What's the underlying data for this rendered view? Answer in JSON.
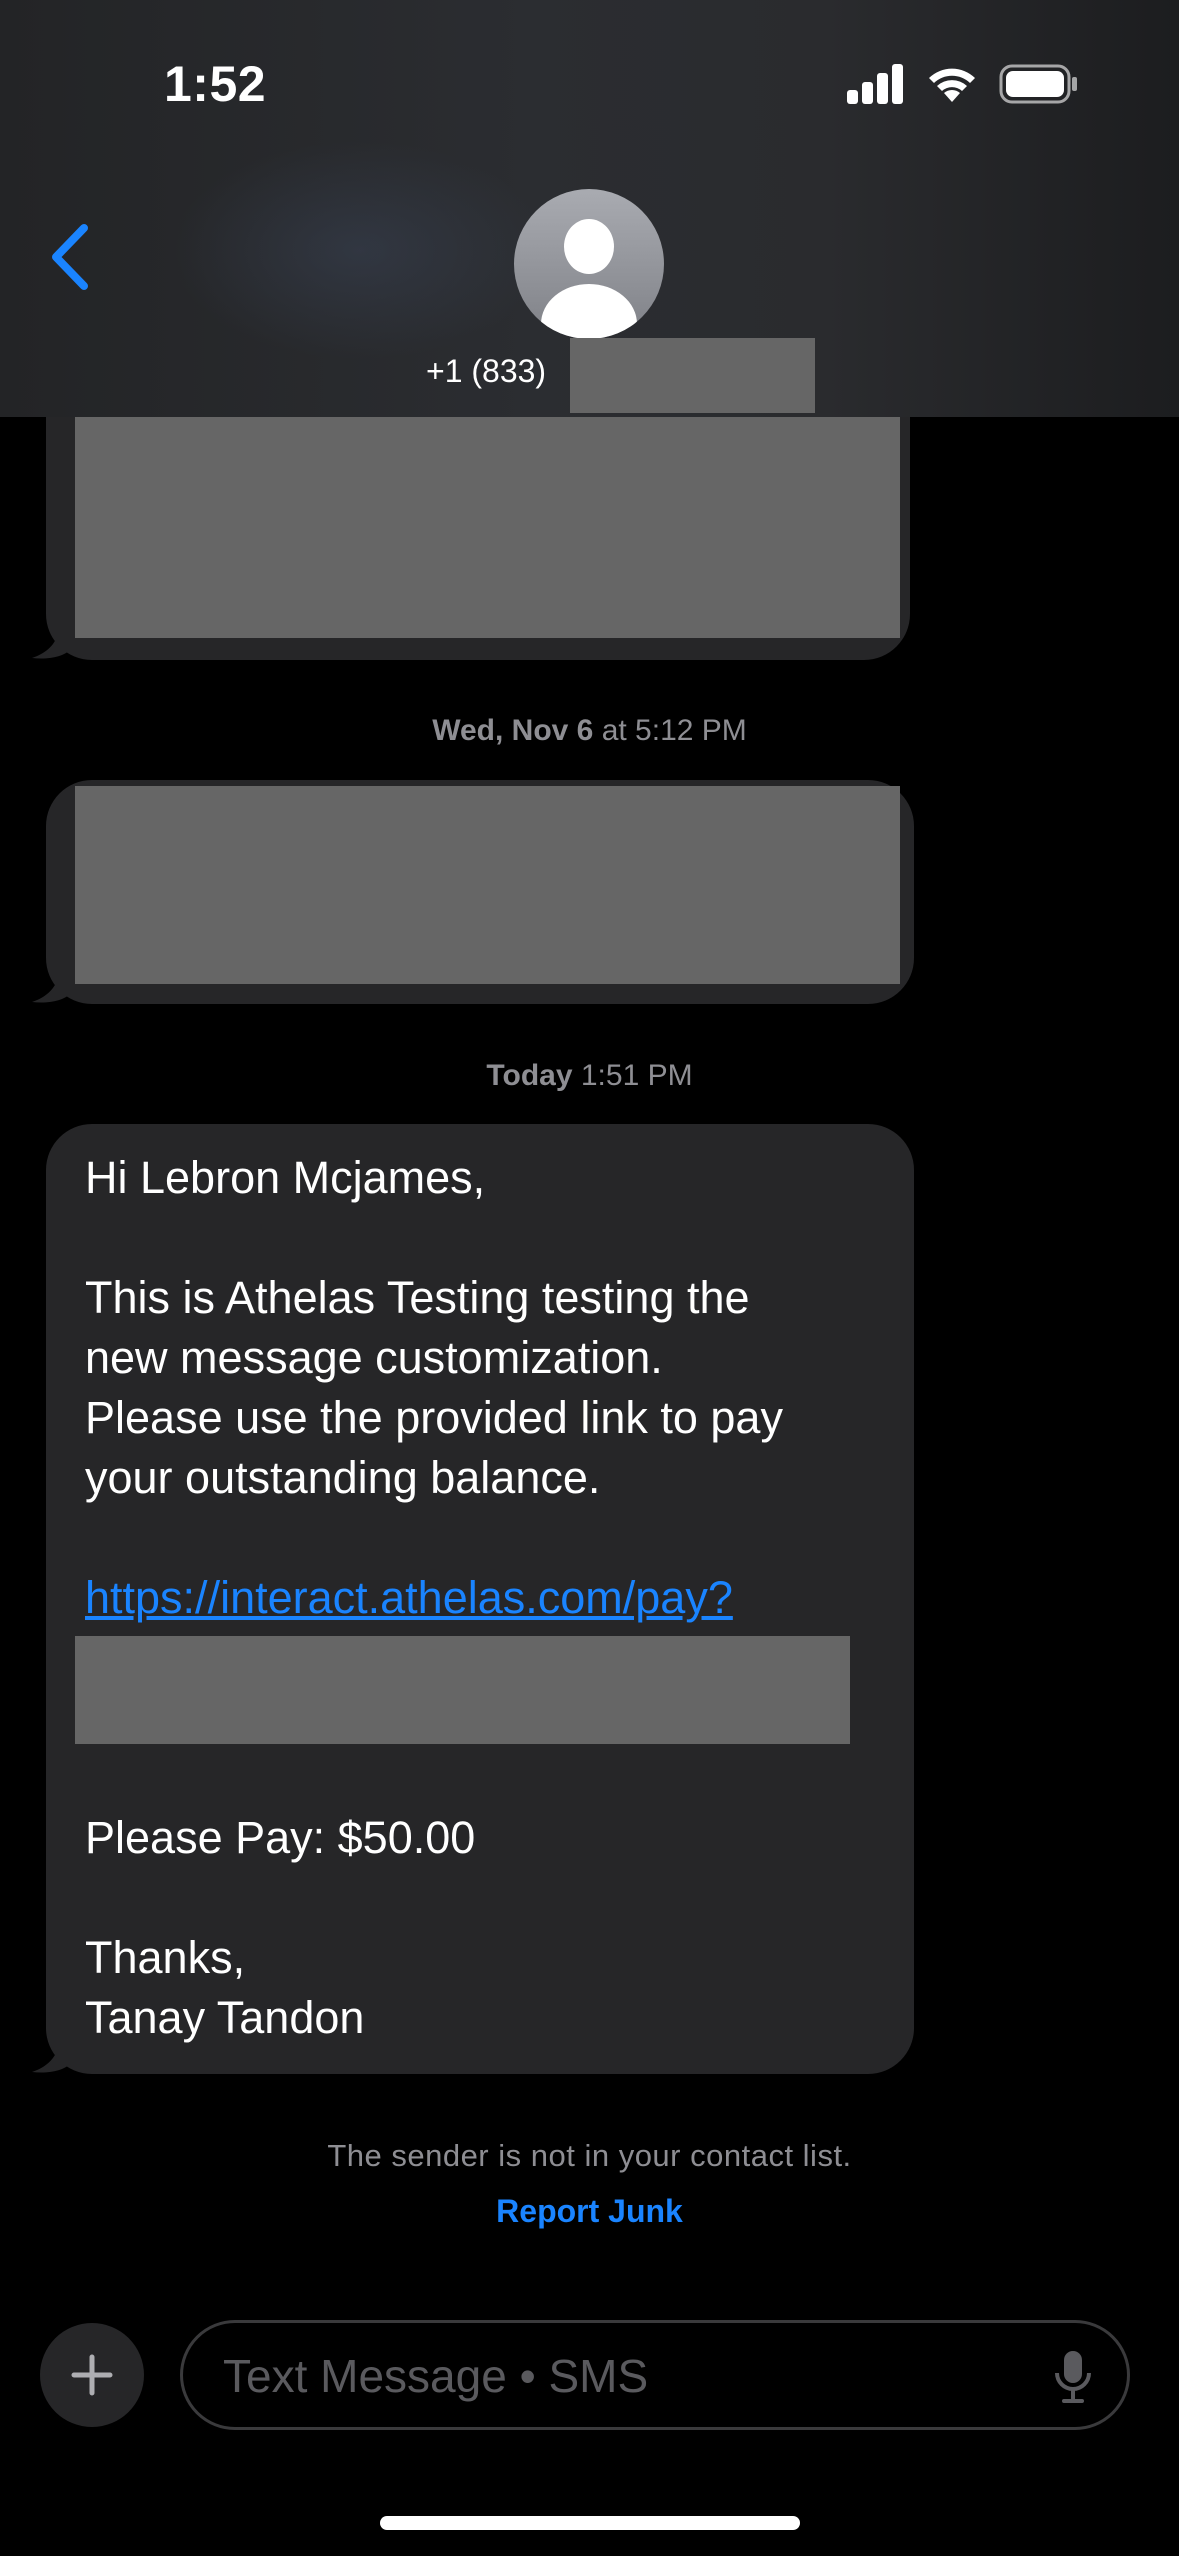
{
  "status_bar": {
    "time": "1:52"
  },
  "header": {
    "contact_number": "+1 (833)"
  },
  "conversation": {
    "timestamps": [
      {
        "day": "Wed, Nov 6",
        "rest": " at 5:12 PM"
      },
      {
        "day": "Today",
        "rest": " 1:51 PM"
      }
    ],
    "message": {
      "greeting": "Hi Lebron Mcjames,",
      "body": "This is Athelas Testing testing the\nnew message customization.\nPlease use the provided link to pay\nyour outstanding balance.",
      "link": "https://interact.athelas.com/pay?",
      "amount": "Please Pay: $50.00",
      "closing": "Thanks,\nTanay Tandon"
    },
    "sender_note": "The sender is not in your contact list.",
    "report_junk": "Report Junk"
  },
  "composer": {
    "placeholder": "Text Message • SMS"
  },
  "colors": {
    "accent": "#1a84ff",
    "bubble": "#262628",
    "redaction": "#666666"
  }
}
